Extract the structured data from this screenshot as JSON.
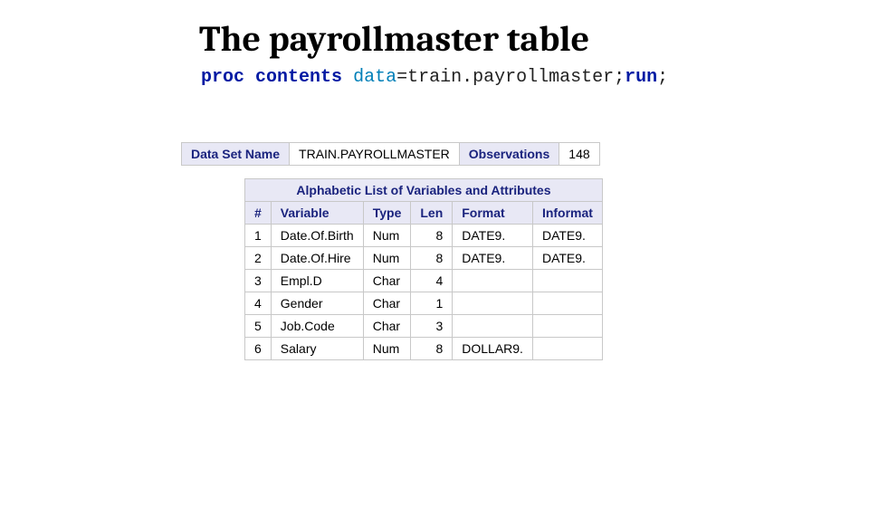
{
  "title": "The payrollmaster table",
  "code": {
    "kw1": "proc",
    "kw2": "contents",
    "opt": "data",
    "val": "=train.payrollmaster;",
    "kw3": "run",
    "tail": ";"
  },
  "meta": {
    "labels": {
      "dsn": "Data Set Name",
      "obs": "Observations"
    },
    "values": {
      "dsn": "TRAIN.PAYROLLMASTER",
      "obs": "148"
    }
  },
  "vars": {
    "caption": "Alphabetic List of Variables and Attributes",
    "headers": {
      "n": "#",
      "var": "Variable",
      "type": "Type",
      "len": "Len",
      "fmt": "Format",
      "inf": "Informat"
    },
    "rows": [
      {
        "n": "1",
        "var": "Date.Of.Birth",
        "type": "Num",
        "len": "8",
        "fmt": "DATE9.",
        "inf": "DATE9."
      },
      {
        "n": "2",
        "var": "Date.Of.Hire",
        "type": "Num",
        "len": "8",
        "fmt": "DATE9.",
        "inf": "DATE9."
      },
      {
        "n": "3",
        "var": "Empl.D",
        "type": "Char",
        "len": "4",
        "fmt": "",
        "inf": ""
      },
      {
        "n": "4",
        "var": "Gender",
        "type": "Char",
        "len": "1",
        "fmt": "",
        "inf": ""
      },
      {
        "n": "5",
        "var": "Job.Code",
        "type": "Char",
        "len": "3",
        "fmt": "",
        "inf": ""
      },
      {
        "n": "6",
        "var": "Salary",
        "type": "Num",
        "len": "8",
        "fmt": "DOLLAR9.",
        "inf": ""
      }
    ]
  }
}
